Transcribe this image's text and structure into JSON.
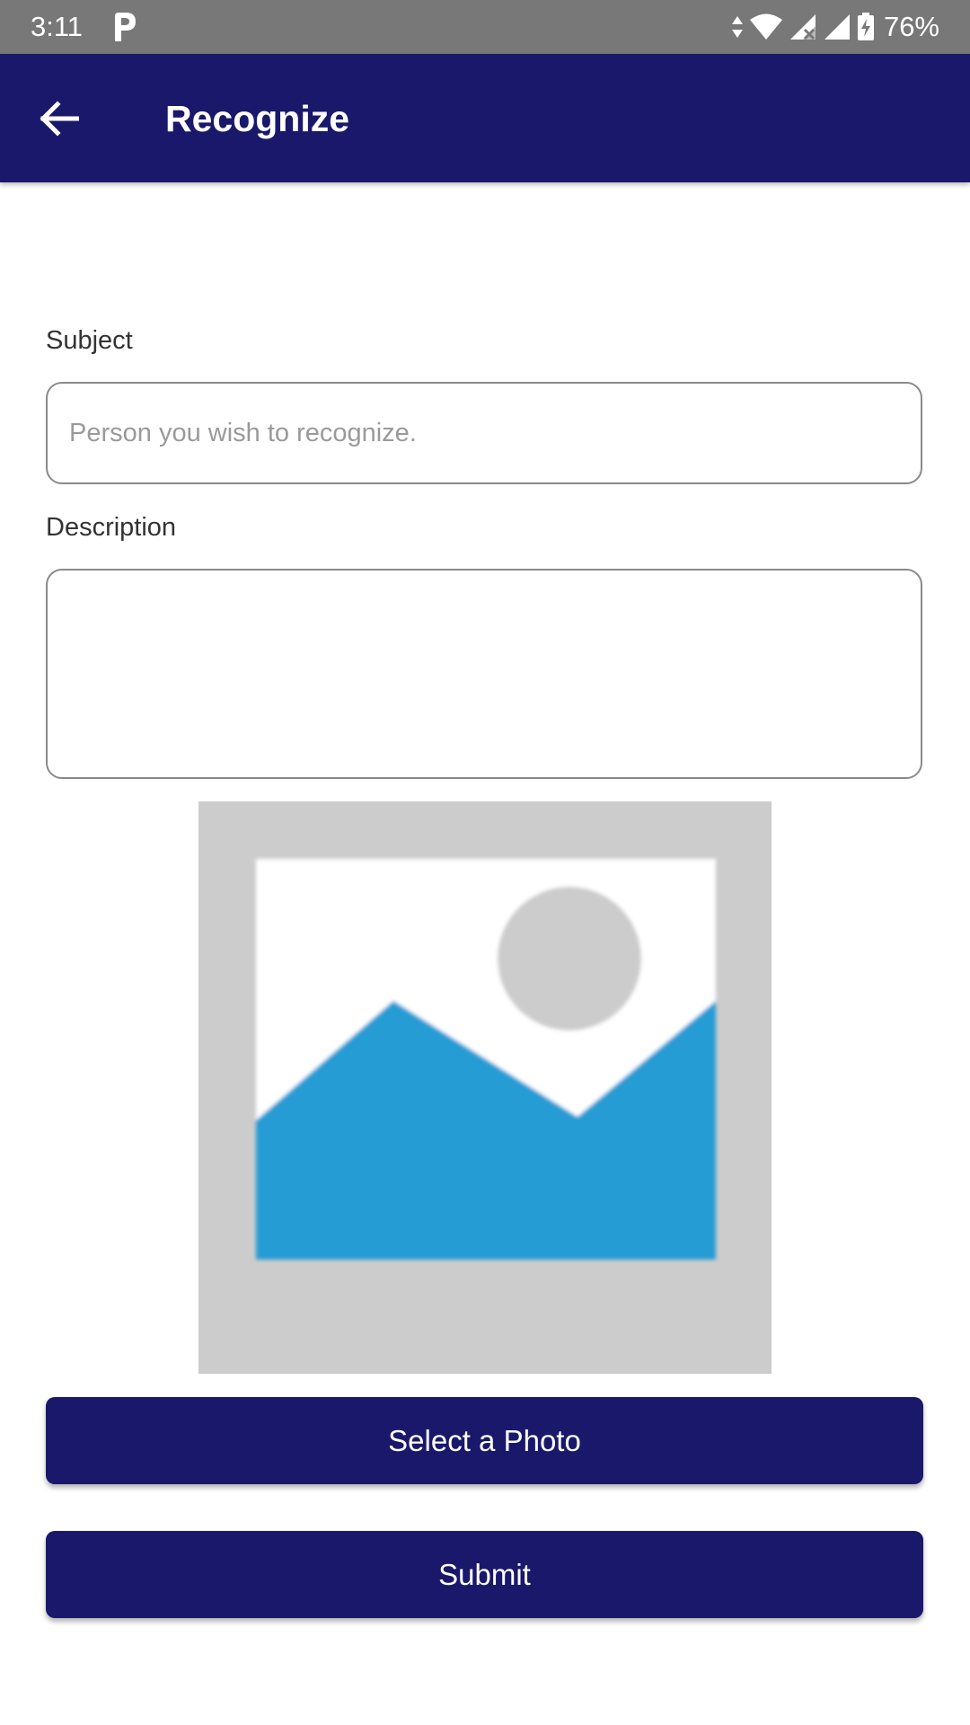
{
  "status_bar": {
    "time": "3:11",
    "battery_percent": "76%",
    "icons": [
      "parking-icon",
      "data-arrows-icon",
      "wifi-icon",
      "signal-x-icon",
      "signal-icon",
      "battery-charging-icon"
    ]
  },
  "app_bar": {
    "title": "Recognize",
    "back_icon": "arrow-left-icon"
  },
  "form": {
    "subject_label": "Subject",
    "subject_placeholder": "Person you wish to recognize.",
    "subject_value": "",
    "description_label": "Description",
    "description_value": ""
  },
  "photo": {
    "placeholder_icon": "image-placeholder-icon"
  },
  "buttons": {
    "select_photo": "Select a Photo",
    "submit": "Submit"
  },
  "colors": {
    "primary": "#1a186b",
    "status_bar": "#787878",
    "image_blue": "#259cd4",
    "image_gray": "#cccccc"
  }
}
